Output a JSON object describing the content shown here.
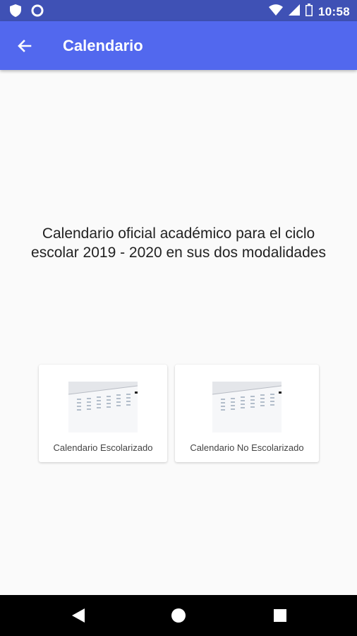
{
  "status_bar": {
    "time": "10:58"
  },
  "app_bar": {
    "title": "Calendario"
  },
  "main": {
    "description": "Calendario oficial académico para el ciclo escolar 2019 - 2020 en sus dos modalidades"
  },
  "cards": [
    {
      "label": "Calendario Escolarizado"
    },
    {
      "label": "Calendario No Escolarizado"
    }
  ],
  "colors": {
    "status_bar": "#3f51b5",
    "app_bar": "#5268ee",
    "background": "#fafafa"
  }
}
